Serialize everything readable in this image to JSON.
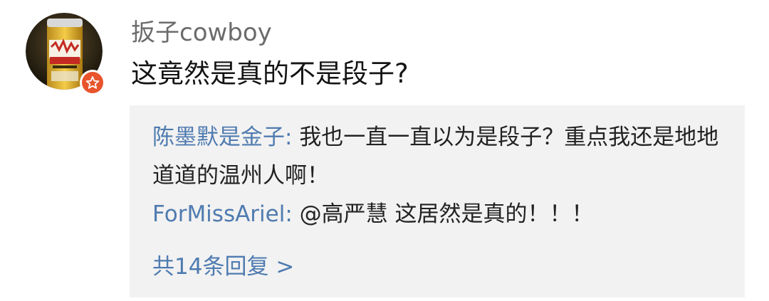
{
  "comment": {
    "username": "扳子cowboy",
    "text": "这竟然是真的不是段子?",
    "avatar_icon": "beer-can-avatar",
    "badge_icon": "star-badge-icon",
    "badge_color": "#e8542c"
  },
  "replies": [
    {
      "user": "陈墨默是金子",
      "separator": ": ",
      "text": "我也一直一直以为是段子？重点我还是地地道道的温州人啊！"
    },
    {
      "user": "ForMissAriel",
      "separator": ": ",
      "text": "@高严慧  这居然是真的！！！"
    }
  ],
  "more_replies": {
    "label": "共14条回复",
    "chevron": ">"
  },
  "colors": {
    "username": "#6b6b6b",
    "link": "#4f7bb0",
    "reply_background": "#f2f2f2",
    "text": "#141414"
  }
}
